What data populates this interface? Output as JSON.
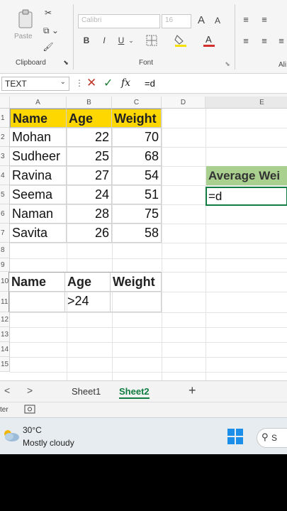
{
  "ribbon": {
    "clipboard_label": "Clipboard",
    "paste_label": "Paste",
    "font_label": "Font",
    "alignment_label": "Ali",
    "font_name": "Calibri",
    "font_size": "16",
    "increase_font": "A",
    "decrease_font": "A",
    "bold": "B",
    "italic": "I",
    "underline": "U"
  },
  "formula_bar": {
    "name_box": "TEXT",
    "cancel_symbol": "✕",
    "enter_symbol": "✓",
    "fx_label": "fx",
    "content": "=d",
    "dots": "⋮"
  },
  "columns": [
    "A",
    "B",
    "C",
    "D",
    "E"
  ],
  "rows": [
    "1",
    "2",
    "3",
    "4",
    "5",
    "6",
    "7",
    "8",
    "9",
    "10",
    "11",
    "12",
    "13",
    "14",
    "15"
  ],
  "table": {
    "headers": [
      "Name",
      "Age",
      "Weight"
    ],
    "rows": [
      [
        "Mohan",
        "22",
        "70"
      ],
      [
        "Sudheer",
        "25",
        "68"
      ],
      [
        "Ravina",
        "27",
        "54"
      ],
      [
        "Seema",
        "24",
        "51"
      ],
      [
        "Naman",
        "28",
        "75"
      ],
      [
        "Savita",
        "26",
        "58"
      ]
    ]
  },
  "criteria": {
    "headers": [
      "Name",
      "Age",
      "Weight"
    ],
    "values": [
      "",
      ">24",
      ""
    ]
  },
  "average": {
    "label": "Average Wei",
    "active_value": "=d"
  },
  "sheets": {
    "nav_prev": "<",
    "nav_next": ">",
    "tabs": [
      "Sheet1",
      "Sheet2"
    ],
    "active": "Sheet2",
    "add": "+"
  },
  "status": {
    "text": "ter"
  },
  "taskbar": {
    "temp": "30°C",
    "weather": "Mostly cloudy",
    "search_label": "S"
  },
  "colors": {
    "header_fill": "#ffd700",
    "average_fill": "#a9d08e",
    "accent": "#107c41"
  }
}
